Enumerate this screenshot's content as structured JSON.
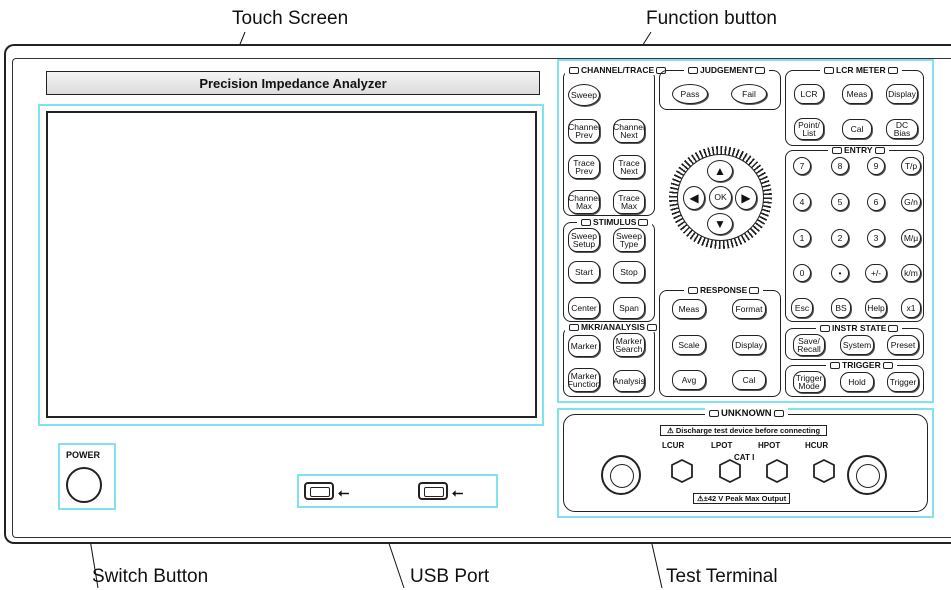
{
  "callouts": {
    "touch_screen": "Touch Screen",
    "function_button": "Function button",
    "switch_button": "Switch Button",
    "usb_port": "USB Port",
    "test_terminal": "Test Terminal"
  },
  "instrument_title": "Precision Impedance Analyzer",
  "power_label": "POWER",
  "groups": {
    "channel_trace": "CHANNEL/TRACE",
    "judgement": "JUDGEMENT",
    "lcr_meter": "LCR METER",
    "entry": "ENTRY",
    "stimulus": "STIMULUS",
    "response": "RESPONSE",
    "mkr_analysis": "MKR/ANALYSIS",
    "instr_state": "INSTR STATE",
    "trigger": "TRIGGER",
    "unknown": "UNKNOWN"
  },
  "buttons": {
    "sweep": "Sweep",
    "channel_prev": "Channel Prev",
    "channel_next": "Channel Next",
    "trace_prev": "Trace Prev",
    "trace_next": "Trace Next",
    "channel_max": "Channel Max",
    "trace_max": "Trace Max",
    "sweep_setup": "Sweep Setup",
    "sweep_type": "Sweep Type",
    "start": "Start",
    "stop": "Stop",
    "center": "Center",
    "span": "Span",
    "marker": "Marker",
    "marker_search": "Marker Search",
    "marker_function": "Marker Function",
    "analysis": "Analysis",
    "pass": "Pass",
    "fail": "Fail",
    "ok": "OK",
    "meas_resp": "Meas",
    "format": "Format",
    "scale": "Scale",
    "display_resp": "Display",
    "avg": "Avg",
    "cal_resp": "Cal",
    "lcr": "LCR",
    "meas_lcr": "Meas",
    "display_lcr": "Display",
    "point_list": "Point/ List",
    "cal_lcr": "Cal",
    "dc_bias": "DC Bias",
    "save_recall": "Save/ Recall",
    "system": "System",
    "preset": "Preset",
    "trigger_mode": "Trigger Mode",
    "hold": "Hold",
    "trigger": "Trigger"
  },
  "keypad": [
    [
      "7",
      "8",
      "9",
      "T/p"
    ],
    [
      "4",
      "5",
      "6",
      "G/n"
    ],
    [
      "1",
      "2",
      "3",
      "M/μ"
    ],
    [
      "0",
      "•",
      "+/-",
      "k/m"
    ],
    [
      "Esc",
      "BS",
      "Help",
      "x1"
    ]
  ],
  "terminal": {
    "warning": "Discharge test device before connecting",
    "lcur": "LCUR",
    "lpot": "LPOT",
    "hpot": "HPOT",
    "hcur": "HCUR",
    "cat": "CAT I",
    "max_output": "±42 V Peak Max Output"
  }
}
